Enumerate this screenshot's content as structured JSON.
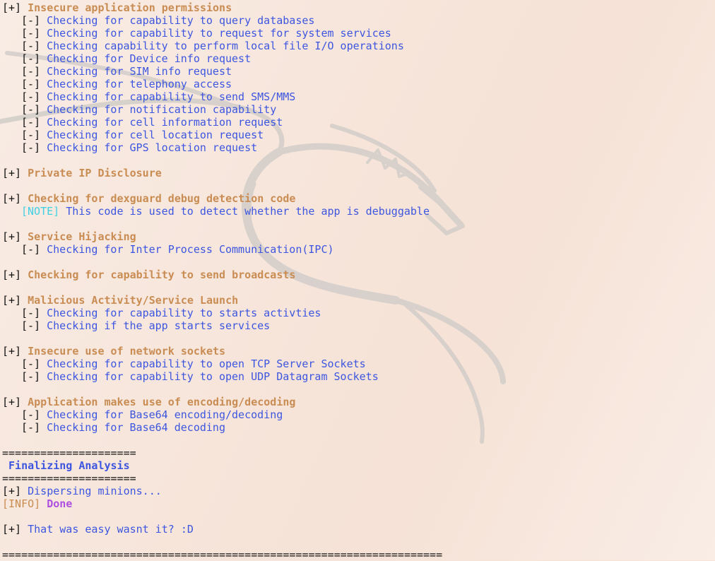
{
  "markers": {
    "plus": "[+]",
    "minus": "[-]",
    "note": "[NOTE]",
    "info": "[INFO]"
  },
  "sections": [
    {
      "title": "Insecure application permissions",
      "items": [
        "Checking for capability to query databases",
        "Checking for capability to request for system services",
        "Checking capability to perform local file I/O operations",
        "Checking for Device info request",
        "Checking for SIM info request",
        "Checking for telephony access",
        "Checking for capability to send SMS/MMS",
        "Checking for notification capability",
        "Checking for cell information request",
        "Checking for cell location request",
        "Checking for GPS location request"
      ]
    },
    {
      "title": "Private IP Disclosure"
    },
    {
      "title": "Checking for dexguard debug detection code",
      "note": "This code is used to detect whether the app is debuggable"
    },
    {
      "title": "Service Hijacking",
      "items": [
        "Checking for Inter Process Communication(IPC)"
      ]
    },
    {
      "title": "Checking for capability to send broadcasts"
    },
    {
      "title": "Malicious Activity/Service Launch",
      "items": [
        "Checking for capability to starts activties",
        "Checking if the app starts services"
      ]
    },
    {
      "title": "Insecure use of network sockets",
      "items": [
        "Checking for capability to open TCP Server Sockets",
        "Checking for capability to open UDP Datagram Sockets"
      ]
    },
    {
      "title": "Application makes use of encoding/decoding",
      "items": [
        "Checking for Base64 encoding/decoding",
        "Checking for Base64 decoding"
      ]
    }
  ],
  "final": {
    "rule_short": "=====================",
    "title": " Finalizing Analysis",
    "dispersing": "Dispersing minions...",
    "done": "Done",
    "easy": "That was easy wasnt it? :D",
    "rule_long": "====================================================================="
  },
  "colors": {
    "header": "#c98c52",
    "text": "#3d56e0",
    "note": "#3fd0e3",
    "done": "#b050e0"
  },
  "background_icon": "kali-dragon-watermark"
}
